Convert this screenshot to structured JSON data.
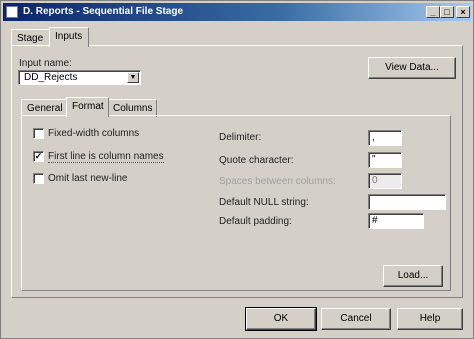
{
  "window": {
    "title": "D. Reports - Sequential File Stage",
    "min_glyph": "_",
    "max_glyph": "□",
    "close_glyph": "×"
  },
  "outer_tabs": [
    "Stage",
    "Inputs"
  ],
  "file_name": {
    "label": "Input name:",
    "value": "DD_Rejects"
  },
  "view_data_label": "View Data...",
  "inner_tabs": [
    "General",
    "Format",
    "Columns"
  ],
  "checkboxes": [
    {
      "label": "Fixed-width columns",
      "checked": false,
      "mark": ""
    },
    {
      "label": "First line is column names",
      "checked": true,
      "mark": "✓"
    },
    {
      "label": "Omit last new-line",
      "checked": false,
      "mark": ""
    }
  ],
  "fields": {
    "delimiter": {
      "label": "Delimiter:",
      "value": ","
    },
    "quote": {
      "label": "Quote character:",
      "value": "\""
    },
    "spaces": {
      "label": "Spaces between columns:",
      "value": "0"
    },
    "null_string": {
      "label": "Default NULL string:",
      "value": ""
    },
    "padding": {
      "label": "Default padding:",
      "value": "#"
    }
  },
  "load_label": "Load...",
  "footer": {
    "ok": "OK",
    "cancel": "Cancel",
    "help": "Help"
  }
}
